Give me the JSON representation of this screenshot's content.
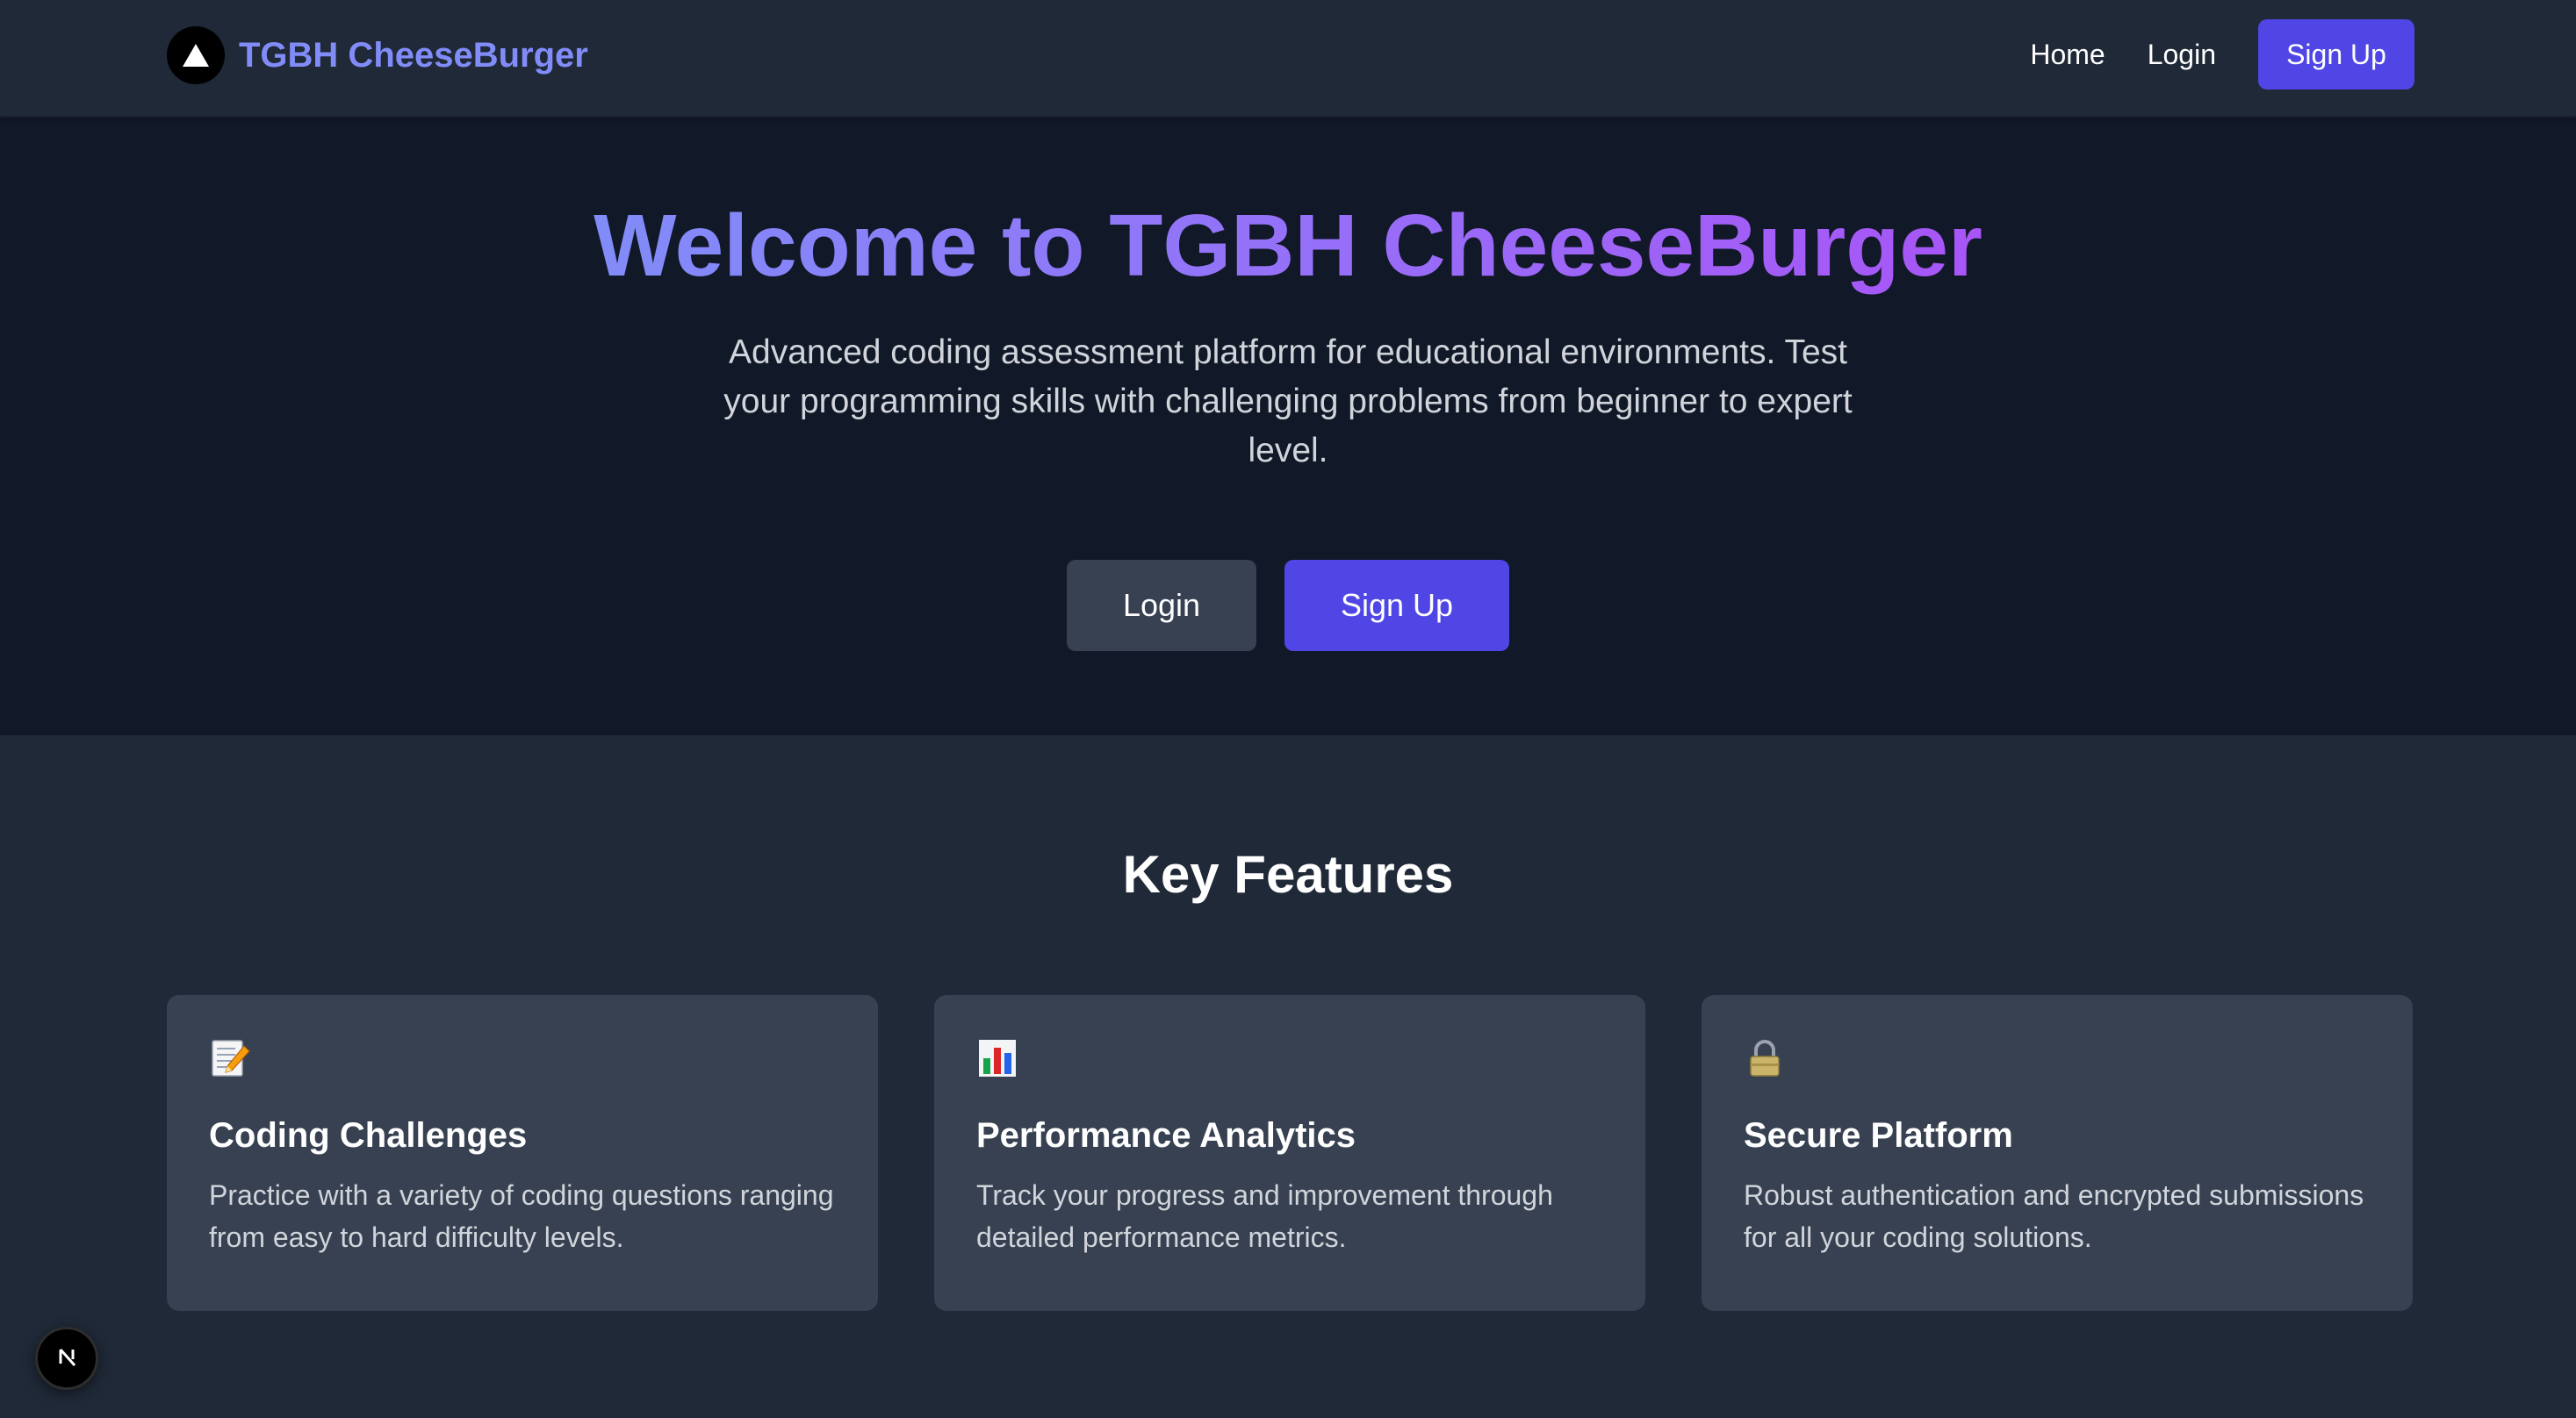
{
  "navbar": {
    "brand_name": "TGBH CheeseBurger",
    "logo_icon": "triangle-logo-icon",
    "links": {
      "home": "Home",
      "login": "Login",
      "signup": "Sign Up"
    }
  },
  "hero": {
    "title": "Welcome to TGBH CheeseBurger",
    "description": "Advanced coding assessment platform for educational environments. Test your programming skills with challenging problems from beginner to expert level.",
    "login_label": "Login",
    "signup_label": "Sign Up"
  },
  "features": {
    "heading": "Key Features",
    "cards": [
      {
        "icon": "memo-icon",
        "title": "Coding Challenges",
        "description": "Practice with a variety of coding questions ranging from easy to hard difficulty levels."
      },
      {
        "icon": "bar-chart-icon",
        "title": "Performance Analytics",
        "description": "Track your progress and improvement through detailed performance metrics."
      },
      {
        "icon": "lock-icon",
        "title": "Secure Platform",
        "description": "Robust authentication and encrypted submissions for all your coding solutions."
      }
    ]
  },
  "dev_badge": {
    "icon": "nextjs-icon"
  },
  "colors": {
    "accent": "#4f46e5",
    "brand_text": "#818cf8",
    "gradient_end": "#a855f7",
    "nav_bg": "#1f2937",
    "hero_bg": "#111827",
    "card_bg": "#374151"
  }
}
